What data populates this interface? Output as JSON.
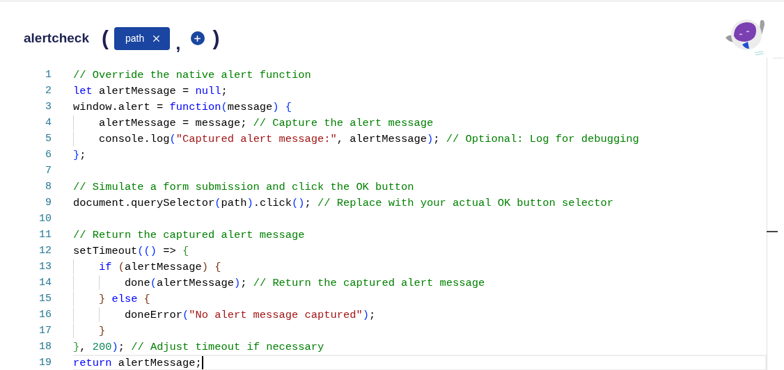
{
  "header": {
    "function_name": "alertcheck",
    "open_paren": "(",
    "separator": ",",
    "close_paren": ")",
    "params": [
      {
        "label": "path"
      }
    ]
  },
  "editor": {
    "lines": [
      {
        "number": "1",
        "tokens": [
          {
            "kind": "comment",
            "t": "// Override the native alert function"
          }
        ]
      },
      {
        "number": "2",
        "tokens": [
          {
            "kind": "keyword",
            "t": "let"
          },
          {
            "kind": "text",
            "t": " alertMessage = "
          },
          {
            "kind": "keyword",
            "t": "null"
          },
          {
            "kind": "text",
            "t": ";"
          }
        ]
      },
      {
        "number": "3",
        "tokens": [
          {
            "kind": "text",
            "t": "window.alert = "
          },
          {
            "kind": "keyword",
            "t": "function"
          },
          {
            "kind": "b1",
            "t": "("
          },
          {
            "kind": "text",
            "t": "message"
          },
          {
            "kind": "b1",
            "t": ") {"
          }
        ]
      },
      {
        "number": "4",
        "tokens": [
          {
            "kind": "text",
            "t": "    alertMessage = message; "
          },
          {
            "kind": "comment",
            "t": "// Capture the alert message"
          }
        ]
      },
      {
        "number": "5",
        "tokens": [
          {
            "kind": "text",
            "t": "    console.log"
          },
          {
            "kind": "b1",
            "t": "("
          },
          {
            "kind": "string",
            "t": "\"Captured alert message:\""
          },
          {
            "kind": "text",
            "t": ", alertMessage"
          },
          {
            "kind": "b1",
            "t": ")"
          },
          {
            "kind": "text",
            "t": "; "
          },
          {
            "kind": "comment",
            "t": "// Optional: Log for debugging"
          }
        ]
      },
      {
        "number": "6",
        "tokens": [
          {
            "kind": "b1",
            "t": "}"
          },
          {
            "kind": "text",
            "t": ";"
          }
        ]
      },
      {
        "number": "7"
      },
      {
        "number": "8",
        "tokens": [
          {
            "kind": "comment",
            "t": "// Simulate a form submission and click the OK button"
          }
        ]
      },
      {
        "number": "9",
        "tokens": [
          {
            "kind": "text",
            "t": "document.querySelector"
          },
          {
            "kind": "b1",
            "t": "("
          },
          {
            "kind": "text",
            "t": "path"
          },
          {
            "kind": "b1",
            "t": ")"
          },
          {
            "kind": "text",
            "t": ".click"
          },
          {
            "kind": "b1",
            "t": "()"
          },
          {
            "kind": "text",
            "t": "; "
          },
          {
            "kind": "comment",
            "t": "// Replace with your actual OK button selector"
          }
        ]
      },
      {
        "number": "10"
      },
      {
        "number": "11",
        "tokens": [
          {
            "kind": "comment",
            "t": "// Return the captured alert message"
          }
        ]
      },
      {
        "number": "12",
        "tokens": [
          {
            "kind": "text",
            "t": "setTimeout"
          },
          {
            "kind": "b1",
            "t": "(()"
          },
          {
            "kind": "text",
            "t": " => "
          },
          {
            "kind": "b2",
            "t": "{"
          }
        ]
      },
      {
        "number": "13",
        "tokens": [
          {
            "kind": "keyword",
            "t": "    if "
          },
          {
            "kind": "b3",
            "t": "("
          },
          {
            "kind": "text",
            "t": "alertMessage"
          },
          {
            "kind": "b3",
            "t": ") {"
          }
        ]
      },
      {
        "number": "14",
        "tokens": [
          {
            "kind": "text",
            "t": "        done"
          },
          {
            "kind": "b1",
            "t": "("
          },
          {
            "kind": "text",
            "t": "alertMessage"
          },
          {
            "kind": "b1",
            "t": ")"
          },
          {
            "kind": "text",
            "t": "; "
          },
          {
            "kind": "comment",
            "t": "// Return the captured alert message"
          }
        ]
      },
      {
        "number": "15",
        "tokens": [
          {
            "kind": "b3",
            "t": "    } "
          },
          {
            "kind": "keyword",
            "t": "else "
          },
          {
            "kind": "b3",
            "t": "{"
          }
        ]
      },
      {
        "number": "16",
        "tokens": [
          {
            "kind": "text",
            "t": "        doneError"
          },
          {
            "kind": "b1",
            "t": "("
          },
          {
            "kind": "string",
            "t": "\"No alert message captured\""
          },
          {
            "kind": "b1",
            "t": ")"
          },
          {
            "kind": "text",
            "t": ";"
          }
        ]
      },
      {
        "number": "17",
        "tokens": [
          {
            "kind": "b3",
            "t": "    }"
          }
        ]
      },
      {
        "number": "18",
        "tokens": [
          {
            "kind": "b2",
            "t": "}"
          },
          {
            "kind": "text",
            "t": ", "
          },
          {
            "kind": "number",
            "t": "200"
          },
          {
            "kind": "b1",
            "t": ")"
          },
          {
            "kind": "text",
            "t": "; "
          },
          {
            "kind": "comment",
            "t": "// Adjust timeout if necessary"
          }
        ]
      },
      {
        "number": "19",
        "current": true,
        "tokens": [
          {
            "kind": "keyword",
            "t": "return"
          },
          {
            "kind": "text",
            "t": " alertMessage;"
          }
        ]
      }
    ]
  }
}
